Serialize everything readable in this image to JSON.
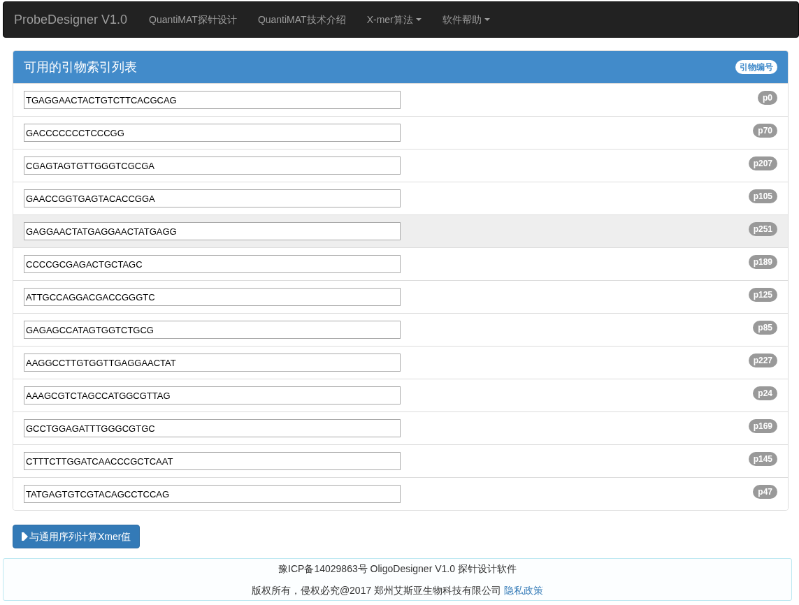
{
  "navbar": {
    "brand": "ProbeDesigner V1.0",
    "items": [
      {
        "label": "QuantiMAT探针设计",
        "dropdown": false
      },
      {
        "label": "QuantiMAT技术介绍",
        "dropdown": false
      },
      {
        "label": "X-mer算法",
        "dropdown": true
      },
      {
        "label": "软件帮助",
        "dropdown": true
      }
    ]
  },
  "panel": {
    "title": "可用的引物索引列表",
    "header_badge": "引物编号",
    "rows": [
      {
        "sequence": "TGAGGAACTACTGTCTTCACGCAG",
        "badge": "p0",
        "hovered": false
      },
      {
        "sequence": "GACCCCCCCTCCCGG",
        "badge": "p70",
        "hovered": false
      },
      {
        "sequence": "CGAGTAGTGTTGGGTCGCGA",
        "badge": "p207",
        "hovered": false
      },
      {
        "sequence": "GAACCGGTGAGTACACCGGA",
        "badge": "p105",
        "hovered": false
      },
      {
        "sequence": "GAGGAACTATGAGGAACTATGAGG",
        "badge": "p251",
        "hovered": true
      },
      {
        "sequence": "CCCCGCGAGACTGCTAGC",
        "badge": "p189",
        "hovered": false
      },
      {
        "sequence": "ATTGCCAGGACGACCGGGTC",
        "badge": "p125",
        "hovered": false
      },
      {
        "sequence": "GAGAGCCATAGTGGTCTGCG",
        "badge": "p85",
        "hovered": false
      },
      {
        "sequence": "AAGGCCTTGTGGTTGAGGAACTAT",
        "badge": "p227",
        "hovered": false
      },
      {
        "sequence": "AAAGCGTCTAGCCATGGCGTTAG",
        "badge": "p24",
        "hovered": false
      },
      {
        "sequence": "GCCTGGAGATTTGGGCGTGC",
        "badge": "p169",
        "hovered": false
      },
      {
        "sequence": "CTTTCTTGGATCAACCCGCTCAAT",
        "badge": "p145",
        "hovered": false
      },
      {
        "sequence": "TATGAGTGTCGTACAGCCTCCAG",
        "badge": "p47",
        "hovered": false
      }
    ]
  },
  "action_button": "与通用序列计算Xmer值",
  "footer": {
    "line1": "豫ICP备14029863号 OligoDesigner V1.0 探针设计软件",
    "line2": "版权所有，侵权必究@2017 郑州艾斯亚生物科技有限公司",
    "link": "隐私政策"
  }
}
